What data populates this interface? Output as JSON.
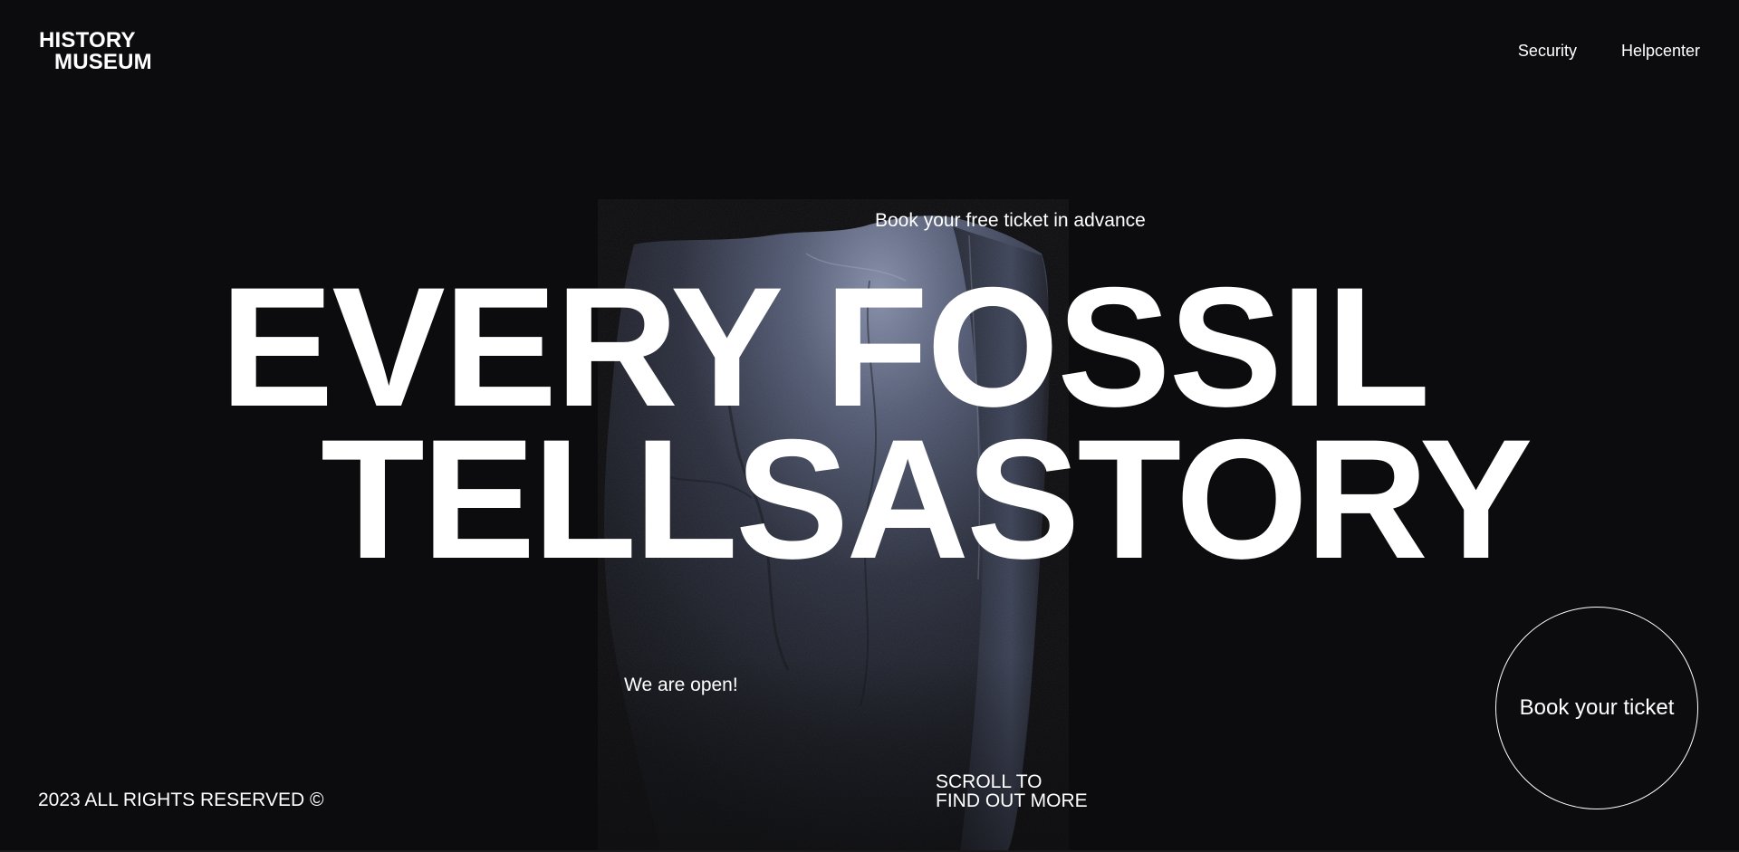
{
  "logo": {
    "line1": "HISTORY",
    "line2": "MUSEUM"
  },
  "nav": {
    "items": [
      {
        "label": "Security"
      },
      {
        "label": "Helpcenter"
      }
    ]
  },
  "hero": {
    "tagline": "Book your free ticket in advance",
    "headline_line1": "EVERY FOSSIL",
    "headline_line2": "TELLSASTORY",
    "open_status": "We are open!",
    "book_button": "Book your ticket"
  },
  "footer": {
    "copyright": "2023 ALL RIGHTS RESERVED ©",
    "scroll_line1": "SCROLL TO",
    "scroll_line2": "FIND OUT MORE"
  },
  "colors": {
    "background": "#0c0c0e",
    "text": "#ffffff",
    "rock_highlight": "#6f7893",
    "rock_shadow": "#15161c"
  },
  "icons": {
    "hero_image": "fossil-rock"
  }
}
